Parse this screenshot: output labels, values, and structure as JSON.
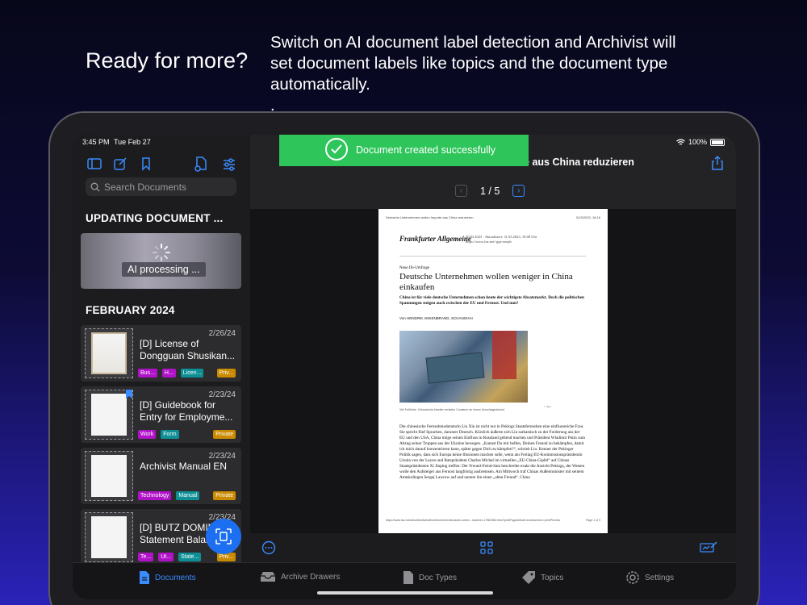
{
  "hero": {
    "title": "Ready for more?",
    "description": "Switch on AI document label detection and Archivist will set document labels like topics and the document type automatically.",
    "dot": "."
  },
  "status_bar": {
    "time": "3:45 PM",
    "date": "Tue Feb 27",
    "battery": "100%"
  },
  "sidebar": {
    "search_placeholder": "Search Documents",
    "updating_header": "UPDATING DOCUMENT ...",
    "ai_processing": "AI processing ...",
    "month_header": "FEBRUARY 2024",
    "documents": [
      {
        "date": "2/26/24",
        "title": "[D] License of Dongguan Shusikan...",
        "tags": [
          "Bus...",
          "H...",
          "Licen..."
        ],
        "privacy": "Priv..."
      },
      {
        "date": "2/23/24",
        "title": "[D] Guidebook for Entry for Employme...",
        "tags": [
          "Work",
          "Form"
        ],
        "privacy": "Private"
      },
      {
        "date": "2/23/24",
        "title": "Archivist Manual EN",
        "tags": [
          "Technology",
          "Manual"
        ],
        "privacy": "Private"
      },
      {
        "date": "2/23/24",
        "title": "[D] BUTZ DOMIN... Statement Balan...",
        "tags": [
          "Te...",
          "Ut...",
          "State..."
        ],
        "privacy": "Priv..."
      }
    ]
  },
  "toast": {
    "message": "Document created successfully"
  },
  "document": {
    "header_title": "rte aus China reduzieren",
    "page_indicator": "1 / 5",
    "paper": {
      "meta_left": "Deutsche Unternehmen wollen Importe aus China reduzieren",
      "meta_right": "01/3/2023, 16:16",
      "masthead": "Frankfurter Allgemeine",
      "published": "30.03.2023 · Aktualisiert: 31.03.2023, 10:08 Uhr https://www.faz.net/-gqe-aoepb",
      "kicker": "Neue Ifo-Umfrage",
      "headline": "Deutsche Unternehmen wollen weniger in China einkaufen",
      "lead": "China ist für viele deutsche Unternehmen schon heute der wichtigste Absatzmarkt. Doch die politischen Spannungen steigen auch zwischen der EU und Fernost. Und nun?",
      "author": "Von HENDRIK ANKENBRAND, SCHANGHAI",
      "caption": "Viel Faßhöhe: Chinesische Arbeiter verladen Container an einem Umschlagbahnhof",
      "credit": "© dpa",
      "body": "Die chinesische Fernsehmoderatorin Liu Xin ist nicht nur in Pekings Staatsfernsehen eine einflussreiche Frau. Sie spricht fünf Sprachen, darunter Deutsch. Kürzlich äußerte sich Liu sarkastisch zu der Forderung aus der EU und den USA, China möge seinen Einfluss in Russland geltend machen und Präsident Wladimir Putin zum Abzug seiner Truppen aus der Ukraine bewegen. „Kannst Du mir helfen, Deinen Freund zu bekämpfen, damit ich mich darauf konzentrieren kann, später gegen Dich zu kämpfen?“, schrieb Liu. Kenner der Pekinger Politik sagen, dass sich Europa keine Illusionen machen solle, wenn am Freitag EU-Kommissionspräsidentin Ursula von der Leyen und Ratspräsident Charles Michel im virtuellen „EU-China-Gipfel“ auf Chinas Staatspräsidenten Xi Jinping treffen: Der Freund-Feind-Satz beschreibe exakt die Ansicht Pekings, der Westen wolle den Aufsteiger aus Fernost langfristig ausbremsen. Am Mittwoch traf Chinas Außenminister mit seinem Amtskollegen Sergej Lawrow auf und nannte ihn einen „alten Freund“. China",
      "footer_left": "https://www.faz.net/aktuell/wirtschaft/unternehmen/deutsche-untern...duzieren-17862383.html?printPagedArticle=true&service=printPreview",
      "footer_right": "Page 1 of 3"
    }
  },
  "tabbar": {
    "tabs": [
      {
        "label": "Documents",
        "icon": "document-icon",
        "active": true
      },
      {
        "label": "Archive Drawers",
        "icon": "tray-icon",
        "active": false
      },
      {
        "label": "Doc Types",
        "icon": "doc-icon",
        "active": false
      },
      {
        "label": "Topics",
        "icon": "tag-icon",
        "active": false
      },
      {
        "label": "Settings",
        "icon": "gear-icon",
        "active": false
      }
    ]
  },
  "colors": {
    "accent": "#3a8bff",
    "toast": "#2ec55a",
    "tag_purple": "#b012c8",
    "tag_teal": "#0e8f96",
    "tag_orange": "#c98a00"
  }
}
